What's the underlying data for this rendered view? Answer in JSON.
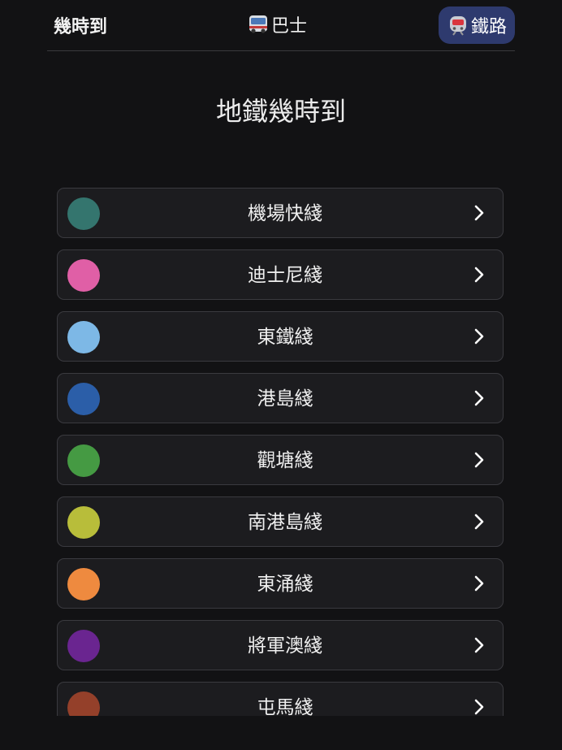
{
  "nav": {
    "brand": "幾時到",
    "bus_label": "巴士",
    "bus_icon": "bus-icon",
    "rail_label": "鐵路",
    "rail_icon": "train-icon",
    "active": "rail",
    "active_color": "#2e3a6e"
  },
  "page": {
    "title": "地鐵幾時到"
  },
  "lines": [
    {
      "name": "機場快綫",
      "color": "#34756e"
    },
    {
      "name": "迪士尼綫",
      "color": "#e05fa6"
    },
    {
      "name": "東鐵綫",
      "color": "#7db8e6"
    },
    {
      "name": "港島綫",
      "color": "#2b5ea8"
    },
    {
      "name": "觀塘綫",
      "color": "#459a43"
    },
    {
      "name": "南港島綫",
      "color": "#b8bd3a"
    },
    {
      "name": "東涌綫",
      "color": "#ee8a3f"
    },
    {
      "name": "將軍澳綫",
      "color": "#6a2590"
    },
    {
      "name": "屯馬綫",
      "color": "#94402a"
    }
  ]
}
